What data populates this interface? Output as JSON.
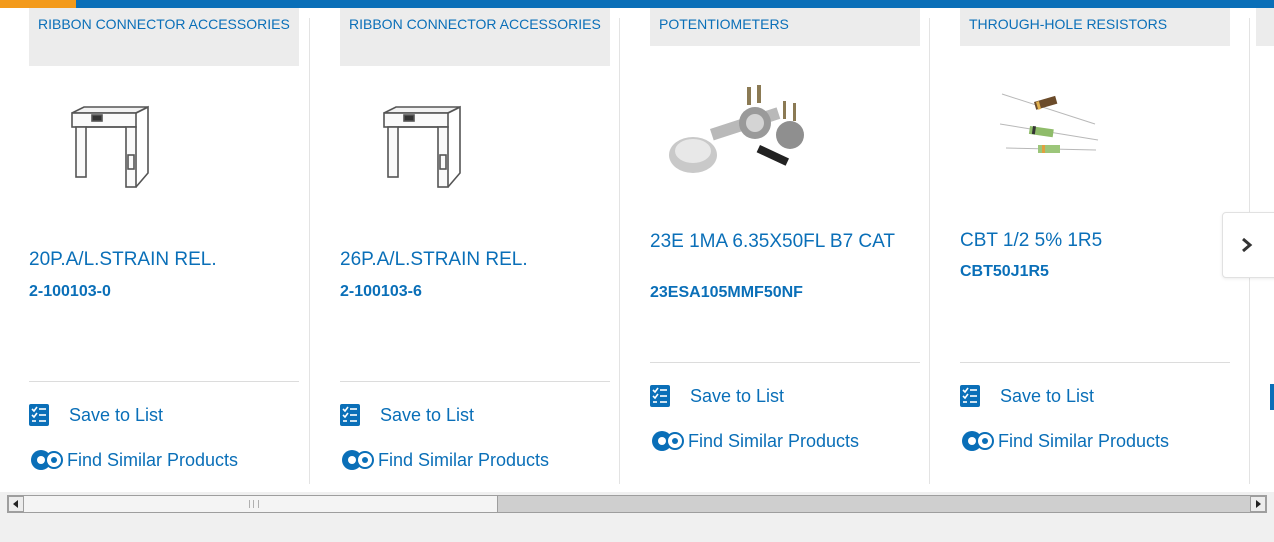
{
  "colors": {
    "brand": "#0a6fb8",
    "accent": "#f39a1b"
  },
  "actions": {
    "save_label": "Save to List",
    "similar_label": "Find Similar Products"
  },
  "cards": [
    {
      "category": "RIBBON CONNECTOR ACCESSORIES",
      "title": "20P.A/L.STRAIN REL.",
      "part": "2-100103-0",
      "image": "strain-relief-bracket"
    },
    {
      "category": "RIBBON CONNECTOR ACCESSORIES",
      "title": "26P.A/L.STRAIN REL.",
      "part": "2-100103-6",
      "image": "strain-relief-bracket"
    },
    {
      "category": "POTENTIOMETERS",
      "title": "23E 1MA 6.35X50FL B7 CAT",
      "part": "23ESA105MMF50NF",
      "image": "potentiometers"
    },
    {
      "category": "THROUGH-HOLE RESISTORS",
      "title": "CBT 1/2 5% 1R5",
      "part": "CBT50J1R5",
      "image": "resistors"
    }
  ],
  "nav": {
    "next_icon": "chevron-right-icon"
  },
  "scrollbar": {
    "position": 0.0,
    "visible_fraction": 0.37
  }
}
